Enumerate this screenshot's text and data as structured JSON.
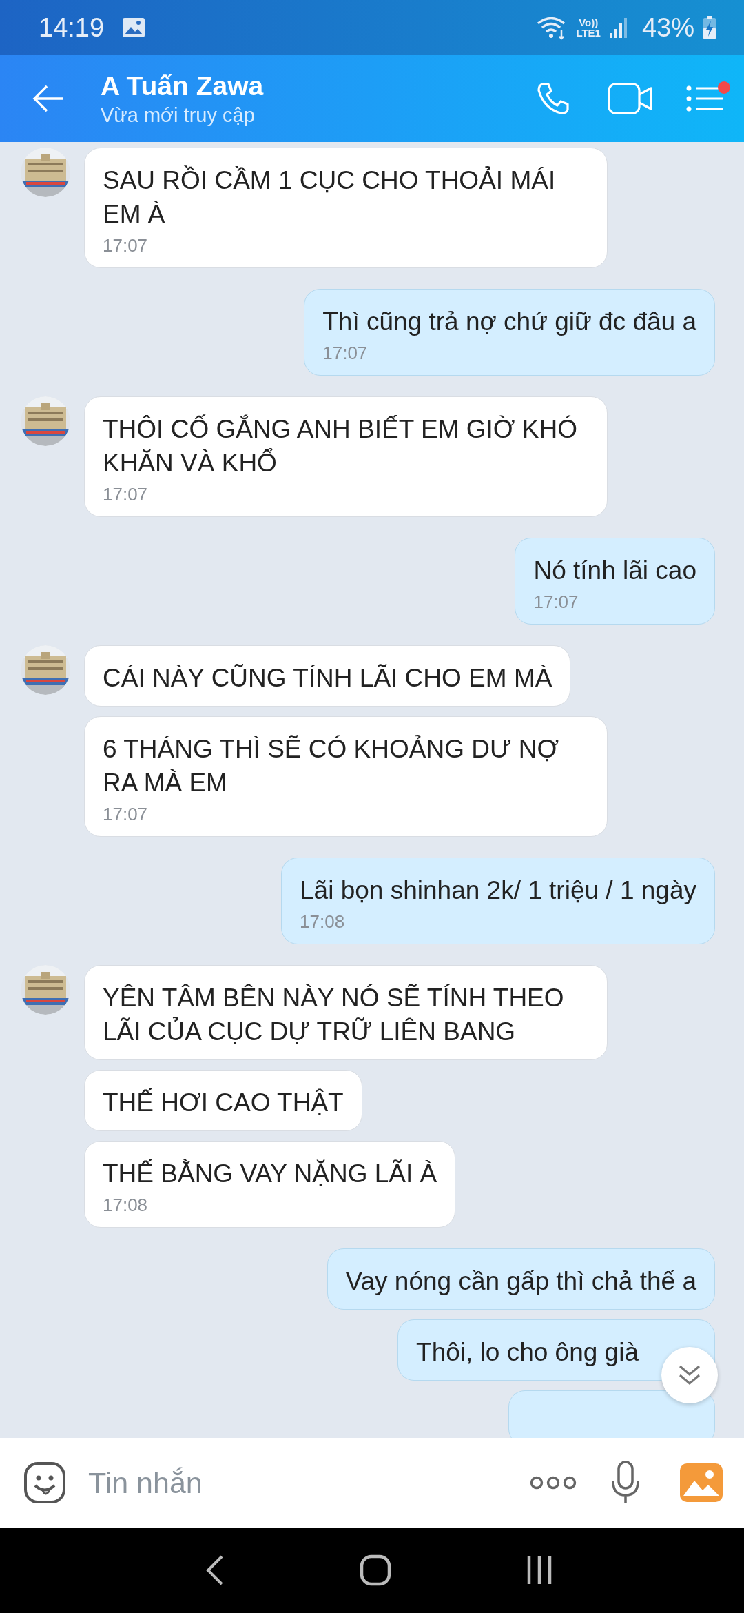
{
  "status_bar": {
    "time": "14:19",
    "volte": "Vo))",
    "network": "LTE1",
    "battery": "43%"
  },
  "header": {
    "name": "A Tuấn Zawa",
    "status": "Vừa mới truy cập",
    "menu_notification": true
  },
  "messages": [
    {
      "kind": "incoming",
      "avatar": true,
      "text": "SAU RỒI CẦM 1 CỤC CHO THOẢI MÁI EM À",
      "time": "17:07"
    },
    {
      "kind": "outgoing",
      "text": "Thì cũng trả nợ chứ giữ đc đâu a",
      "time": "17:07"
    },
    {
      "kind": "incoming",
      "avatar": true,
      "text": "THÔI CỐ GẮNG ANH BIẾT EM GIỜ KHÓ KHĂN VÀ KHỔ",
      "time": "17:07"
    },
    {
      "kind": "outgoing",
      "text": "Nó tính lãi cao",
      "time": "17:07"
    },
    {
      "kind": "incoming",
      "avatar": true,
      "text": "CÁI NÀY CŨNG TÍNH LÃI CHO EM MÀ"
    },
    {
      "kind": "incoming",
      "avatar": false,
      "text": "6 THÁNG THÌ SẼ CÓ KHOẢNG DƯ NỢ RA MÀ EM",
      "time": "17:07"
    },
    {
      "kind": "outgoing",
      "text": "Lãi bọn shinhan 2k/ 1 triệu / 1 ngày",
      "time": "17:08"
    },
    {
      "kind": "incoming",
      "avatar": true,
      "text": "YÊN TÂM BÊN NÀY NÓ SẼ TÍNH THEO LÃI CỦA CỤC DỰ TRỮ LIÊN BANG"
    },
    {
      "kind": "incoming",
      "avatar": false,
      "text": "THẾ HƠI CAO THẬT"
    },
    {
      "kind": "incoming",
      "avatar": false,
      "text": "THẾ BẰNG VAY NẶNG LÃI À",
      "time": "17:08"
    },
    {
      "kind": "outgoing",
      "text": "Vay nóng cần gấp thì chả thế a"
    },
    {
      "kind": "outgoing",
      "text": "Thôi, lo cho ông già"
    },
    {
      "kind": "outgoing"
    }
  ],
  "composer": {
    "placeholder": "Tin nhắn"
  }
}
